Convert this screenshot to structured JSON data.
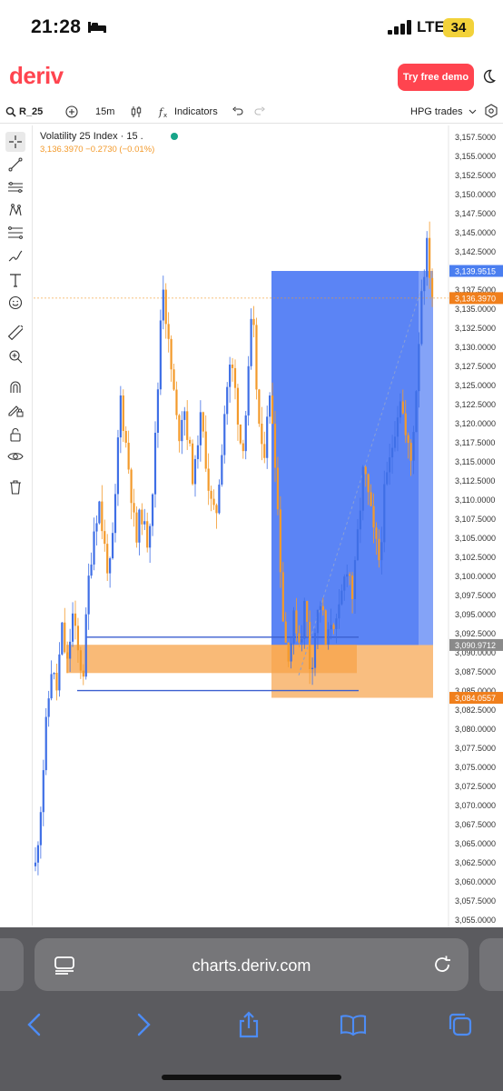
{
  "status_bar": {
    "time": "21:28",
    "network": "LTE",
    "battery": "34",
    "icons": [
      "bed-icon",
      "signal-icon"
    ]
  },
  "header": {
    "logo": "deriv",
    "cta_label": "Try free demo",
    "theme_icon": "moon-icon",
    "accent": "#ff444f"
  },
  "toolbar": {
    "symbol": "R_25",
    "interval": "15m",
    "indicators_label": "Indicators",
    "trades_label": "HPG trades",
    "icons": [
      "search-icon",
      "add-icon",
      "candles-icon",
      "fx-icon",
      "undo-icon",
      "redo-icon",
      "chevron-down-icon",
      "settings-icon"
    ]
  },
  "drawing_tools": [
    "crosshair-icon",
    "line-icon",
    "channel-icon",
    "pattern-icon",
    "fib-icon",
    "brush-icon",
    "text-icon",
    "emoji-icon",
    "ruler-icon",
    "zoom-icon",
    "magnet-icon",
    "lock-drawing-icon",
    "lock-icon",
    "eye-icon",
    "trash-icon"
  ],
  "legend": {
    "title": "Volatility 25 Index · 15 .",
    "values": "3,136.3970  −0.2730 (−0.01%)"
  },
  "chart_data": {
    "type": "candlestick",
    "title": "Volatility 25 Index · 15 .",
    "ylim": [
      3054,
      3159
    ],
    "y_ticks": [
      "3,157.5000",
      "3,155.0000",
      "3,152.5000",
      "3,150.0000",
      "3,147.5000",
      "3,145.0000",
      "3,142.5000",
      "3,140.0000",
      "3,137.5000",
      "3,135.0000",
      "3,132.5000",
      "3,130.0000",
      "3,127.5000",
      "3,125.0000",
      "3,122.5000",
      "3,120.0000",
      "3,117.5000",
      "3,115.0000",
      "3,112.5000",
      "3,110.0000",
      "3,107.5000",
      "3,105.0000",
      "3,102.5000",
      "3,100.0000",
      "3,097.5000",
      "3,095.0000",
      "3,092.5000",
      "3,090.0000",
      "3,087.5000",
      "3,085.0000",
      "3,082.5000",
      "3,080.0000",
      "3,077.5000",
      "3,075.0000",
      "3,072.5000",
      "3,070.0000",
      "3,067.5000",
      "3,065.0000",
      "3,062.5000",
      "3,060.0000",
      "3,057.5000",
      "3,055.0000"
    ],
    "price_tags": [
      {
        "label": "3,139.9515",
        "value": 3139.9515,
        "color": "#4a7ef0"
      },
      {
        "label": "3,136.3970",
        "value": 3136.397,
        "color": "#f07f1c"
      },
      {
        "label": "3,090.9712",
        "value": 3090.9712,
        "color": "#8a8a8a"
      },
      {
        "label": "3,084.0557",
        "value": 3084.0557,
        "color": "#f07f1c"
      }
    ],
    "current_price": 3136.397,
    "path": [
      3062,
      3070,
      3080,
      3088,
      3085,
      3093,
      3088,
      3095,
      3090,
      3087,
      3099,
      3106,
      3110,
      3104,
      3100,
      3108,
      3124,
      3118,
      3112,
      3104,
      3109,
      3104,
      3110,
      3122,
      3140,
      3131,
      3125,
      3118,
      3123,
      3117,
      3112,
      3121,
      3117,
      3110,
      3107,
      3115,
      3124,
      3128,
      3123,
      3116,
      3123,
      3135,
      3122,
      3114,
      3124,
      3120,
      3106,
      3092,
      3090,
      3095,
      3091,
      3097,
      3087,
      3094,
      3097,
      3090,
      3095,
      3093,
      3098,
      3102,
      3097,
      3106,
      3114,
      3110,
      3105,
      3102,
      3111,
      3115,
      3120,
      3124,
      3118,
      3115,
      3125,
      3138,
      3143,
      3137
    ],
    "up_color": "#3f6fe6",
    "down_color": "#f39a2b",
    "zones": [
      {
        "kind": "target",
        "from": 3090.97,
        "to": 3139.95,
        "color": "#2d62f2"
      },
      {
        "kind": "stop",
        "from": 3084.06,
        "to": 3090.97,
        "color": "#f7a34a"
      },
      {
        "kind": "order-block",
        "from": 3087.3,
        "to": 3091.0,
        "color": "#f7a34a"
      }
    ],
    "levels": [
      {
        "value": 3092.0,
        "color": "#3b5fd0"
      },
      {
        "value": 3085.0,
        "color": "#3b5fd0"
      }
    ]
  },
  "browser": {
    "url": "charts.deriv.com",
    "icons": [
      "tabs-left-icon",
      "reader-icon",
      "reload-icon",
      "back-icon",
      "forward-icon",
      "share-icon",
      "bookmarks-icon",
      "tabs-icon"
    ]
  }
}
